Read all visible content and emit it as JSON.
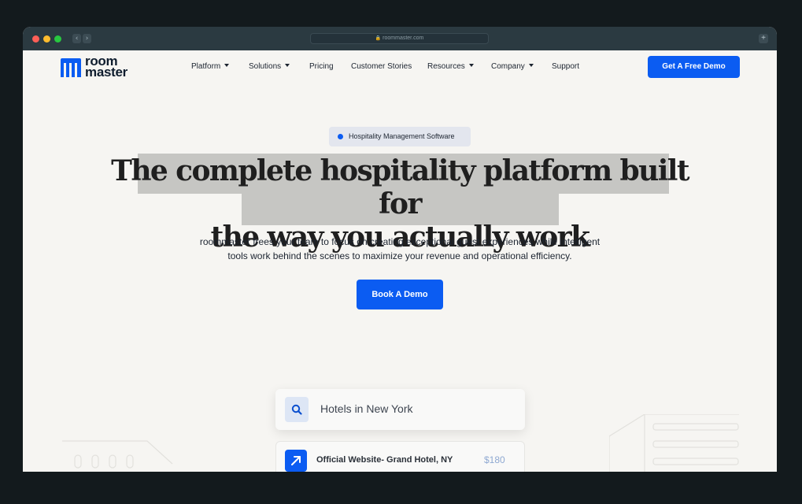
{
  "browser": {
    "url": "roommaster.com",
    "back_glyph": "‹",
    "forward_glyph": "›",
    "new_tab_glyph": "+"
  },
  "logo": {
    "line1": "room",
    "line2": "master"
  },
  "nav": {
    "items": [
      {
        "label": "Platform",
        "dropdown": true
      },
      {
        "label": "Solutions",
        "dropdown": true
      },
      {
        "label": "Pricing",
        "dropdown": false
      },
      {
        "label": "Customer Stories",
        "dropdown": false
      },
      {
        "label": "Resources",
        "dropdown": true
      },
      {
        "label": "Company",
        "dropdown": true
      },
      {
        "label": "Support",
        "dropdown": false
      }
    ],
    "cta_label": "Get A Free Demo"
  },
  "hero": {
    "badge": "Hospitality Management Software",
    "headline_line1": "The complete hospitality platform built for",
    "headline_line2": "the way you actually work",
    "subtext_line1": "roommaster frees your team to focus on creating exceptional guest experiences while intelligent",
    "subtext_line2": "tools work behind the scenes to maximize your revenue and operational efficiency.",
    "cta_label": "Book A Demo"
  },
  "preview": {
    "search_text": "Hotels in New York",
    "result_title": "Official Website- Grand Hotel, NY",
    "result_price": "$180"
  },
  "colors": {
    "brand_blue": "#0b5cf2",
    "page_bg": "#f6f5f2",
    "chrome_bg": "#2b3a41",
    "outer_bg": "#131a1d",
    "text_dark": "#1c2430",
    "highlight": "#c6c6c3"
  },
  "icons": {
    "search": "search-icon",
    "result": "arrow-up-right-icon",
    "caret": "chevron-down-icon",
    "lock": "lock-icon"
  }
}
